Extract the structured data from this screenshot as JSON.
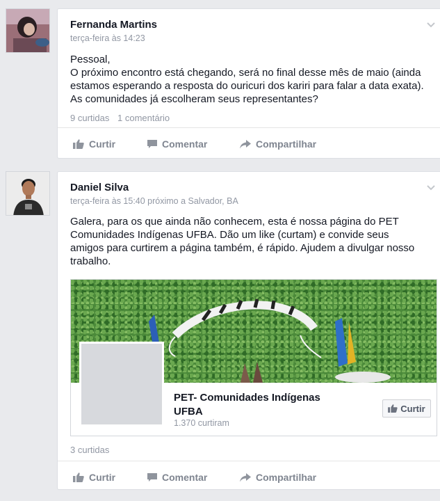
{
  "posts": [
    {
      "author": "Fernanda Martins",
      "meta": "terça-feira às 14:23",
      "text": "Pessoal,\nO próximo encontro está chegando, será no final desse mês de maio (ainda estamos esperando a resposta do ouricuri dos kariri para falar a data exata). As comunidades já escolheram seus representantes?",
      "likes": "9 curtidas",
      "comments": "1 comentário"
    },
    {
      "author": "Daniel Silva",
      "meta": "terça-feira às 15:40 próximo a Salvador, BA",
      "text": "Galera, para os que ainda não conhecem, esta é nossa página do PET Comunidades Indígenas UFBA. Dão  um like (curtam) e convide seus amigos para curtirem a página também, é rápido. Ajudem a divulgar nosso trabalho.",
      "likes": "3 curtidas",
      "link_preview": {
        "page_name": "PET- Comunidades Indígenas UFBA",
        "page_likes": "1.370 curtiram",
        "like_button": "Curtir"
      }
    }
  ],
  "actions": {
    "like": "Curtir",
    "comment": "Comentar",
    "share": "Compartilhar"
  },
  "icons": {
    "like": "thumbs-up-icon",
    "comment": "speech-bubble-icon",
    "share": "share-arrow-icon",
    "menu": "chevron-down-icon"
  },
  "colors": {
    "background": "#e9eaed",
    "action_text": "#7f8590",
    "meta_text": "#9197a3"
  }
}
